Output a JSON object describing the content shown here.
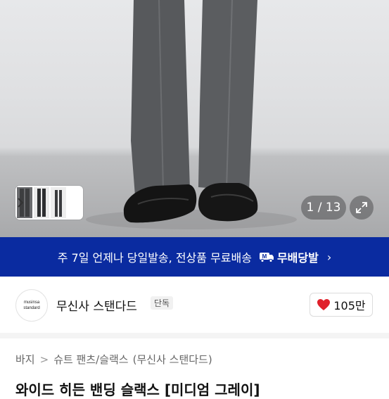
{
  "gallery": {
    "counter": "1 / 13",
    "thumb_next_icon": "chevron-right-icon",
    "expand_icon": "expand-icon"
  },
  "banner": {
    "text": "주 7일 언제나 당일발송, 전상품 무료배송",
    "badge": "무배당발",
    "badge_icon": "m-truck-icon",
    "arrow": "›",
    "color": "#0a2ba0"
  },
  "brand": {
    "logo_line1": "musinsa",
    "logo_line2": "standard",
    "name": "무신사 스탠다드",
    "tag": "단독",
    "likes": "105만",
    "heart_color": "#e0202a"
  },
  "breadcrumb": {
    "items": [
      "바지",
      "슈트 팬츠/슬랙스",
      "(무신사 스탠다드)"
    ],
    "separator": ">"
  },
  "product": {
    "title": "와이드 히든 밴딩 슬랙스 [미디엄 그레이]"
  }
}
